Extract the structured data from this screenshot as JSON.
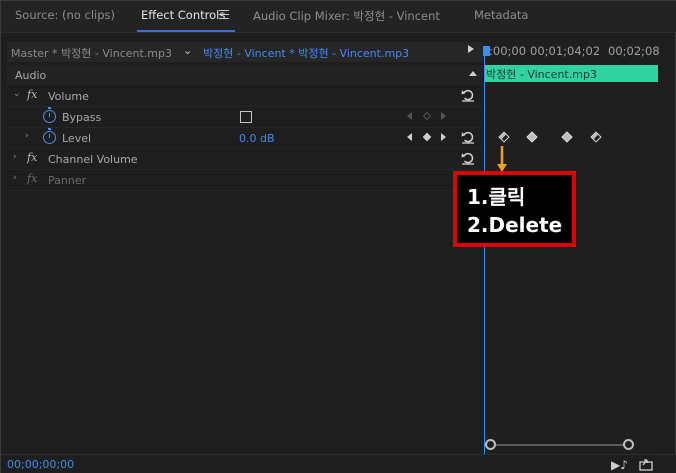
{
  "tabs": [
    {
      "label": "Source: (no clips)",
      "active": false
    },
    {
      "label": "Effect Controls",
      "active": true
    },
    {
      "label": "Audio Clip Mixer: 박정현 - Vincent",
      "active": false
    },
    {
      "label": "Metadata",
      "active": false
    }
  ],
  "header": {
    "master_label": "Master * 박정현 - Vincent.mp3",
    "clip_label": "박정현 - Vincent * 박정현 - Vincent.mp3"
  },
  "section": {
    "label": "Audio"
  },
  "effects": {
    "volume": {
      "label": "Volume"
    },
    "bypass": {
      "label": "Bypass",
      "checked": false
    },
    "level": {
      "label": "Level",
      "value": "0.0 dB"
    },
    "channel_volume": {
      "label": "Channel Volume"
    },
    "panner": {
      "label": "Panner"
    }
  },
  "timeline": {
    "ticks": [
      ":00;00",
      "00;01;04;02",
      "00;02;08"
    ],
    "clip_label": "박정현 - Vincent.mp3",
    "clip_color": "#30d3a0",
    "playhead_color": "#3f8cf2"
  },
  "annotation": {
    "line1": "1.클릭",
    "line2": "2.Delete",
    "border_color": "#e00000",
    "arrow_color": "#f0a020"
  },
  "status": {
    "timecode": "00;00;00;00"
  },
  "icons": {
    "fx": "fx-icon",
    "stopwatch": "stopwatch-icon",
    "reset": "reset-icon",
    "play_audio": "play-audio-icon",
    "export": "export-icon"
  }
}
